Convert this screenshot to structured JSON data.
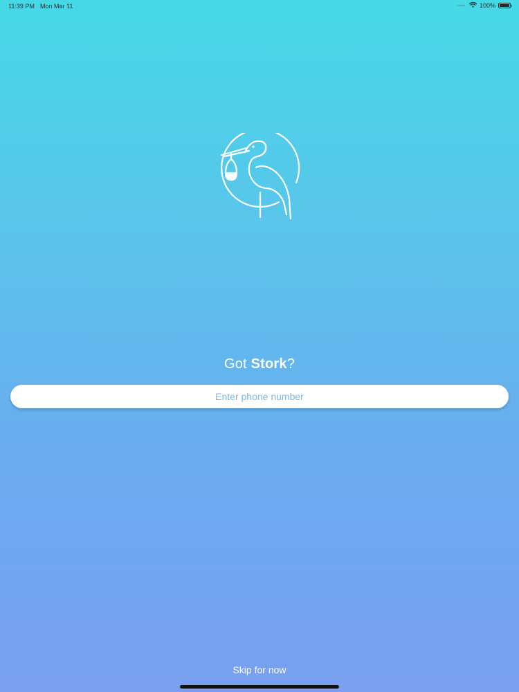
{
  "status_bar": {
    "time": "11:39 PM",
    "date": "Mon Mar 11",
    "battery": "100%",
    "battery_level": 1.0,
    "wifi_icon": "wifi-icon",
    "battery_icon": "battery-icon"
  },
  "logo": {
    "icon": "stork-logo-icon"
  },
  "headline": {
    "prefix": "Got ",
    "brand": "Stork",
    "suffix": "?"
  },
  "phone_field": {
    "value": "",
    "placeholder": "Enter phone number"
  },
  "skip": {
    "label": "Skip for now"
  },
  "colors": {
    "gradient_top": "#45d9e6",
    "gradient_bottom": "#7a9ff1",
    "placeholder": "#7fb7df",
    "text": "#ffffff"
  }
}
